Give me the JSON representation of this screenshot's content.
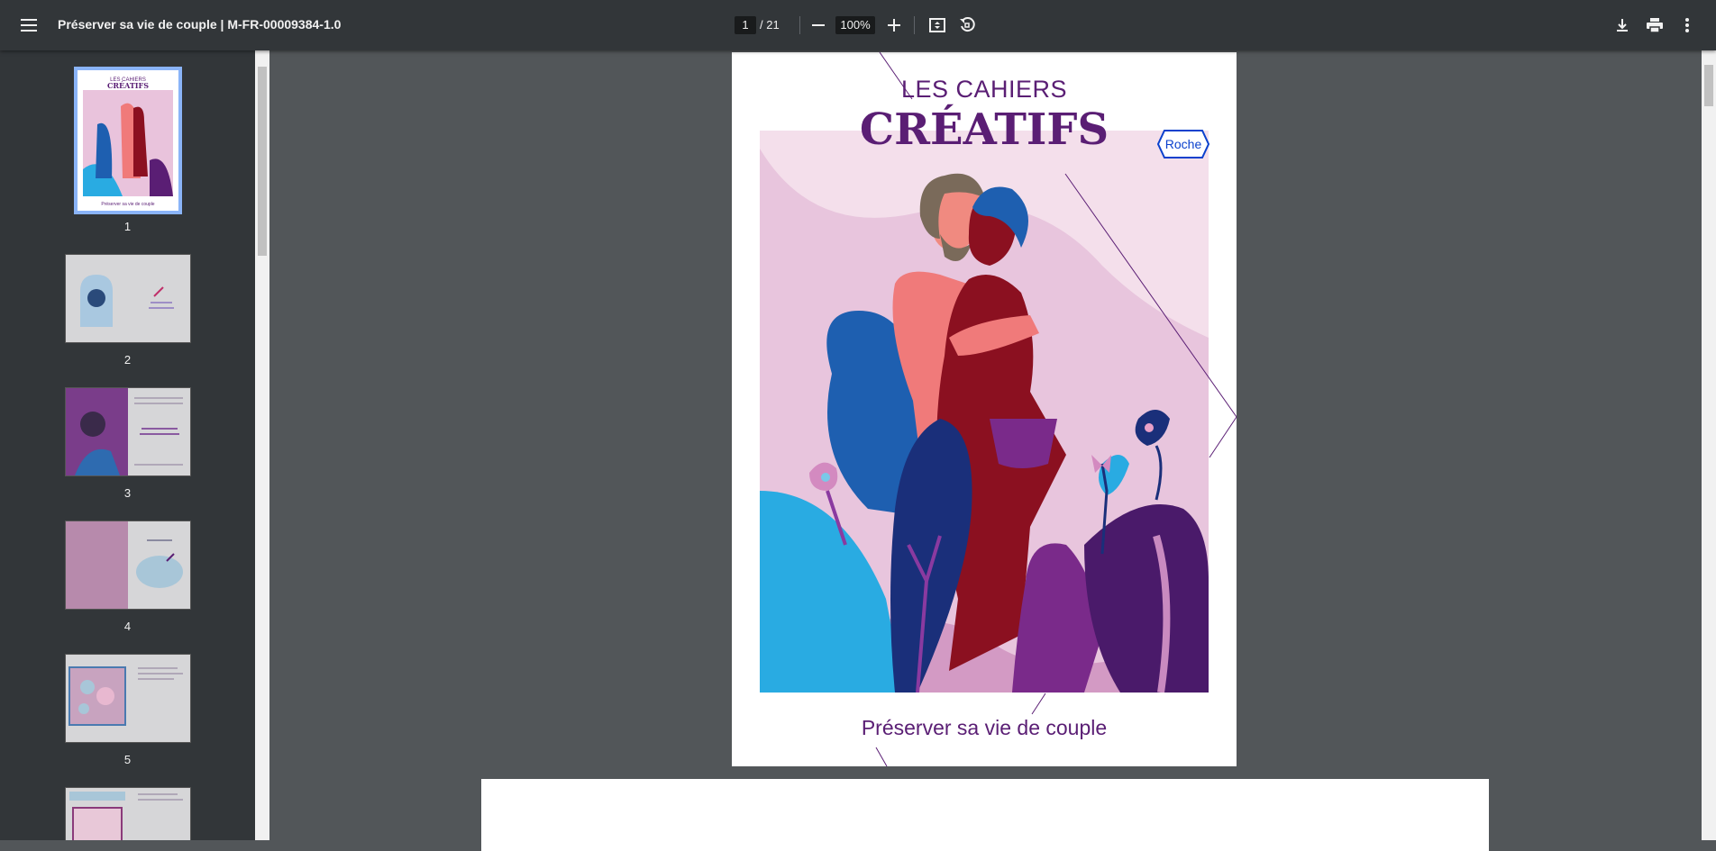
{
  "toolbar": {
    "title": "Préserver sa vie de couple | M-FR-00009384-1.0",
    "page_current": "1",
    "page_total": "/ 21",
    "zoom": "100%",
    "icons": [
      "menu-icon",
      "zoom-out-icon",
      "zoom-in-icon",
      "fit-page-icon",
      "rotate-icon",
      "download-icon",
      "print-icon",
      "more-icon"
    ]
  },
  "sidebar": {
    "thumbnails": [
      {
        "num": "1"
      },
      {
        "num": "2"
      },
      {
        "num": "3"
      },
      {
        "num": "4"
      },
      {
        "num": "5"
      }
    ]
  },
  "cover": {
    "series_label": "LES CAHIERS",
    "series_title": "CRÉATIFS",
    "brand": "Roche",
    "book_title": "Préserver sa vie de couple"
  },
  "colors": {
    "toolbar_bg": "#323639",
    "viewer_bg": "#525659",
    "brand_purple": "#5a1e74",
    "roche_blue": "#0b41cd"
  }
}
